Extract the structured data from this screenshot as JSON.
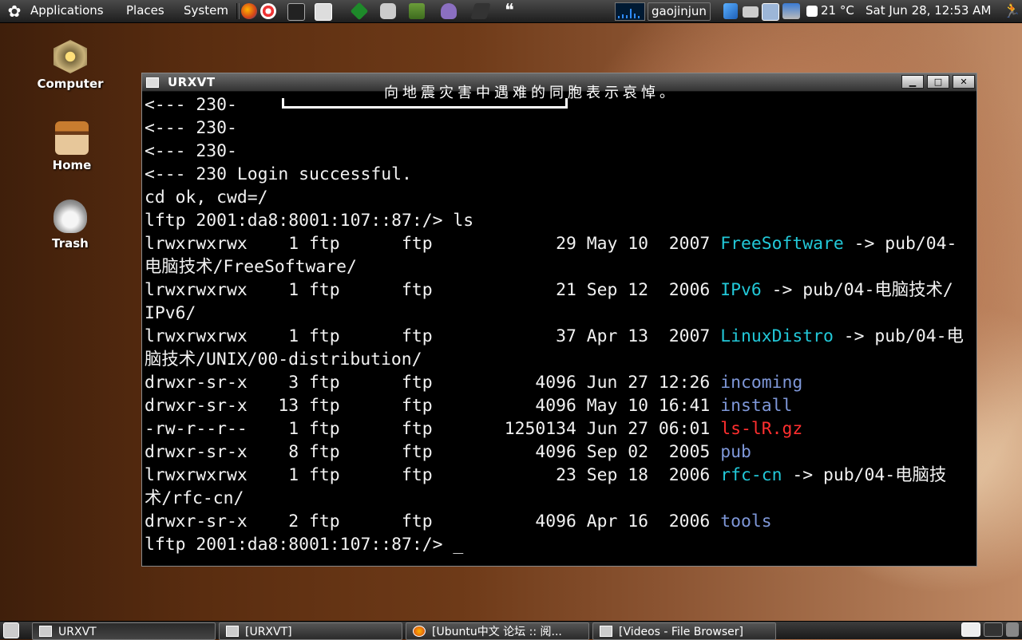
{
  "top_panel": {
    "menus": [
      "Applications",
      "Places",
      "System"
    ],
    "user": "gaojinjun",
    "temperature": "21 °C",
    "datetime": "Sat Jun 28, 12:53 AM"
  },
  "desktop_icons": [
    {
      "label": "Computer",
      "icon": "computer-icon"
    },
    {
      "label": "Home",
      "icon": "home-icon"
    },
    {
      "label": "Trash",
      "icon": "trash-icon"
    }
  ],
  "window": {
    "title": "URXVT",
    "buttons": [
      "minimize",
      "maximize",
      "close"
    ]
  },
  "terminal": {
    "overlay_text": "向地震灾害中遇难的同胞表示哀悼。",
    "lines": [
      [
        {
          "t": "<--- 230-",
          "c": ""
        }
      ],
      [
        {
          "t": "<--- 230-",
          "c": ""
        }
      ],
      [
        {
          "t": "<--- 230-",
          "c": ""
        }
      ],
      [
        {
          "t": "<--- 230 Login successful.",
          "c": ""
        }
      ],
      [
        {
          "t": "cd ok, cwd=/",
          "c": ""
        }
      ],
      [
        {
          "t": "lftp 2001:da8:8001:107::87:/> ls",
          "c": ""
        }
      ],
      [
        {
          "t": "lrwxrwxrwx    1 ftp      ftp            29 May 10  2007 ",
          "c": ""
        },
        {
          "t": "FreeSoftware",
          "c": "cyan"
        },
        {
          "t": " -> pub/04-",
          "c": ""
        }
      ],
      [
        {
          "t": "电脑技术/FreeSoftware/",
          "c": ""
        }
      ],
      [
        {
          "t": "lrwxrwxrwx    1 ftp      ftp            21 Sep 12  2006 ",
          "c": ""
        },
        {
          "t": "IPv6",
          "c": "cyan"
        },
        {
          "t": " -> pub/04-电脑技术/",
          "c": ""
        }
      ],
      [
        {
          "t": "IPv6/",
          "c": ""
        }
      ],
      [
        {
          "t": "lrwxrwxrwx    1 ftp      ftp            37 Apr 13  2007 ",
          "c": ""
        },
        {
          "t": "LinuxDistro",
          "c": "cyan"
        },
        {
          "t": " -> pub/04-电",
          "c": ""
        }
      ],
      [
        {
          "t": "脑技术/UNIX/00-distribution/",
          "c": ""
        }
      ],
      [
        {
          "t": "drwxr-sr-x    3 ftp      ftp          4096 Jun 27 12:26 ",
          "c": ""
        },
        {
          "t": "incoming",
          "c": "blue"
        }
      ],
      [
        {
          "t": "drwxr-sr-x   13 ftp      ftp          4096 May 10 16:41 ",
          "c": ""
        },
        {
          "t": "install",
          "c": "blue"
        }
      ],
      [
        {
          "t": "-rw-r--r--    1 ftp      ftp       1250134 Jun 27 06:01 ",
          "c": ""
        },
        {
          "t": "ls-lR.gz",
          "c": "red"
        }
      ],
      [
        {
          "t": "drwxr-sr-x    8 ftp      ftp          4096 Sep 02  2005 ",
          "c": ""
        },
        {
          "t": "pub",
          "c": "blue"
        }
      ],
      [
        {
          "t": "lrwxrwxrwx    1 ftp      ftp            23 Sep 18  2006 ",
          "c": ""
        },
        {
          "t": "rfc-cn",
          "c": "cyan"
        },
        {
          "t": " -> pub/04-电脑技",
          "c": ""
        }
      ],
      [
        {
          "t": "术/rfc-cn/",
          "c": ""
        }
      ],
      [
        {
          "t": "drwxr-sr-x    2 ftp      ftp          4096 Apr 16  2006 ",
          "c": ""
        },
        {
          "t": "tools",
          "c": "blue"
        }
      ],
      [
        {
          "t": "lftp 2001:da8:8001:107::87:/> _",
          "c": ""
        }
      ]
    ]
  },
  "taskbar": {
    "tasks": [
      "URXVT",
      "[URXVT]",
      "[Ubuntu中文 论坛 :: 阅...",
      "[Videos - File Browser]"
    ]
  },
  "colors": {
    "ls_symlink": "#22c8d8",
    "ls_directory": "#7e97d8",
    "ls_archive": "#ff2f2f",
    "terminal_fg": "#f2f2f2",
    "terminal_bg": "#000000"
  }
}
